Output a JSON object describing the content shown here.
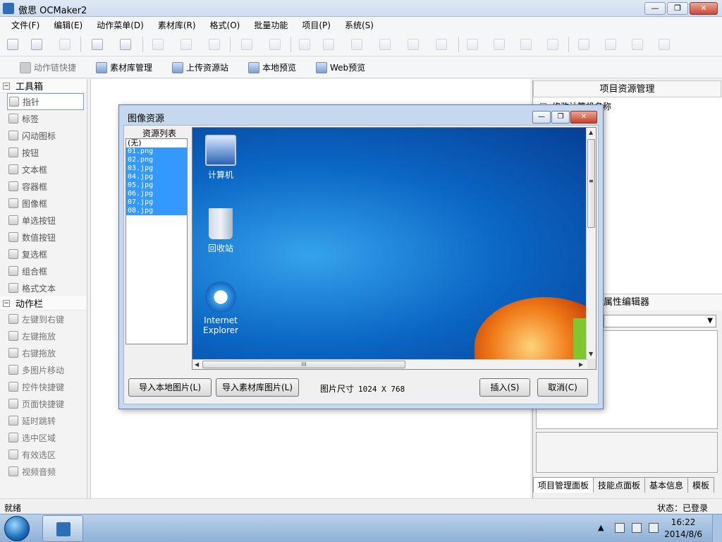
{
  "window": {
    "title": "傲思 OCMaker2",
    "buttons": {
      "minimize": "—",
      "maximize": "❐",
      "close": "✕"
    }
  },
  "menu": [
    "文件(F)",
    "编辑(E)",
    "动作菜单(D)",
    "素材库(R)",
    "格式(O)",
    "批量功能",
    "项目(P)",
    "系统(S)"
  ],
  "toolbar2": {
    "action_chain": "动作链快捷",
    "asset_manage": "素材库管理",
    "upload": "上传资源站",
    "local_preview": "本地预览",
    "web_preview": "Web预览"
  },
  "toolbox": {
    "header": "工具箱",
    "header_toggle": "−",
    "items": [
      "指针",
      "标签",
      "闪动图标",
      "按钮",
      "文本框",
      "容器框",
      "图像框",
      "单选按钮",
      "数值按钮",
      "复选框",
      "组合框",
      "格式文本"
    ],
    "actions_header": "动作栏",
    "actions_toggle": "−",
    "actions": [
      "左键到右键",
      "左键拖放",
      "右键拖放",
      "多图片移动",
      "控件快捷键",
      "页面快捷键",
      "延时跳转",
      "选中区域",
      "有效选区",
      "视频音频"
    ]
  },
  "right_panel": {
    "title": "项目资源管理",
    "tree_node": "修改计算机名称",
    "tree_toggle": "−",
    "prop_title": "属性编辑器",
    "combo_arrow": "▼",
    "tabs": [
      "项目管理面板",
      "技能点面板",
      "基本信息",
      "模板"
    ]
  },
  "dialog": {
    "title": "图像资源",
    "btn_min": "—",
    "btn_max": "❐",
    "btn_close": "✕",
    "list_label": "资源列表",
    "list_items": [
      "(无)",
      "01.png",
      "02.png",
      "03.jpg",
      "04.jpg",
      "05.jpg",
      "06.jpg",
      "07.jpg",
      "08.jpg"
    ],
    "desktop_icons": [
      "计算机",
      "回收站",
      "Internet Explorer"
    ],
    "scroll_grip": "III",
    "scroll_up": "▲",
    "scroll_down": "▼",
    "scroll_left": "◀",
    "scroll_right": "▶",
    "vscroll_grip": "≡",
    "import_local": "导入本地图片(L)",
    "import_library": "导入素材库图片(L)",
    "size_label": "图片尺寸",
    "size_value": "1024 X 768",
    "insert": "插入(S)",
    "cancel": "取消(C)"
  },
  "status": {
    "left": "就绪",
    "right": "状态：已登录"
  },
  "taskbar": {
    "time": "16:22",
    "date": "2014/8/6",
    "tray_arrow": "▲"
  },
  "colors": {
    "selection": "#3399ff",
    "desktop_blue": "#0b66c4",
    "dialog_frame": "#c6d8ee"
  }
}
